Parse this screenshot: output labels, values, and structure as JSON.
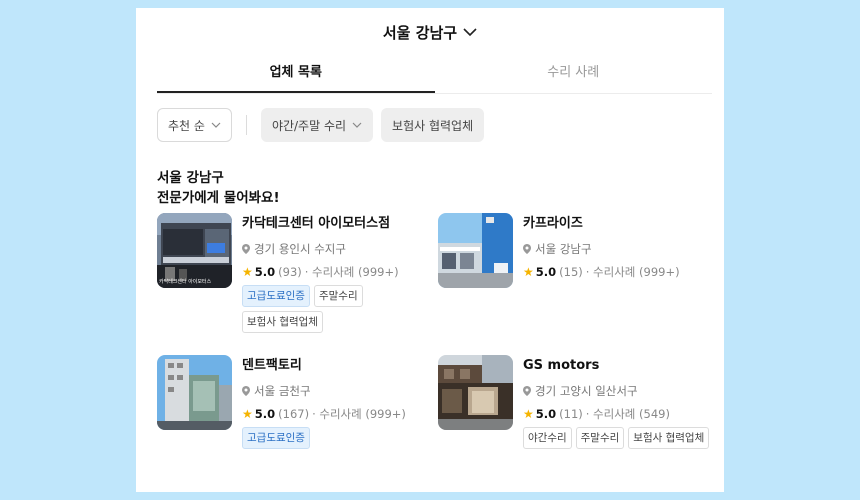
{
  "header": {
    "title": "서울 강남구"
  },
  "tabs": [
    {
      "label": "업체 목록",
      "active": true
    },
    {
      "label": "수리 사례",
      "active": false
    }
  ],
  "filters": {
    "sort": "추천 순",
    "night_weekend": "야간/주말 수리",
    "insurance": "보험사 협력업체"
  },
  "headline": {
    "line1": "서울 강남구",
    "line2": "전문가에게 물어봐요!"
  },
  "shops": [
    {
      "name": "카닥테크센터 아이모터스점",
      "location": "경기 용인시 수지구",
      "score": "5.0",
      "reviews": "(93)",
      "cases": "· 수리사례 (999+)",
      "tags": [
        {
          "label": "고급도료인증",
          "style": "blue"
        },
        {
          "label": "주말수리",
          "style": "plain"
        },
        {
          "label": "보험사 협력업체",
          "style": "plain"
        }
      ],
      "photo_caption": "카닥테크센터 아이모터스"
    },
    {
      "name": "카프라이즈",
      "location": "서울 강남구",
      "score": "5.0",
      "reviews": "(15)",
      "cases": "· 수리사례 (999+)",
      "tags": []
    },
    {
      "name": "덴트팩토리",
      "location": "서울 금천구",
      "score": "5.0",
      "reviews": "(167)",
      "cases": "· 수리사례 (999+)",
      "tags": [
        {
          "label": "고급도료인증",
          "style": "blue"
        }
      ]
    },
    {
      "name": "GS motors",
      "location": "경기 고양시 일산서구",
      "score": "5.0",
      "reviews": "(11)",
      "cases": "· 수리사례 (549)",
      "tags": [
        {
          "label": "야간수리",
          "style": "plain"
        },
        {
          "label": "주말수리",
          "style": "plain"
        },
        {
          "label": "보험사 협력업체",
          "style": "plain"
        }
      ]
    }
  ],
  "colors": {
    "background": "#bfe6fb",
    "star": "#f5b400",
    "tag_blue_bg": "#e4f1fd",
    "tag_blue_text": "#2a6fc4"
  },
  "icons": {
    "region_dropdown": "chevron-down-icon",
    "location": "map-pin-icon",
    "rating": "star-icon"
  }
}
